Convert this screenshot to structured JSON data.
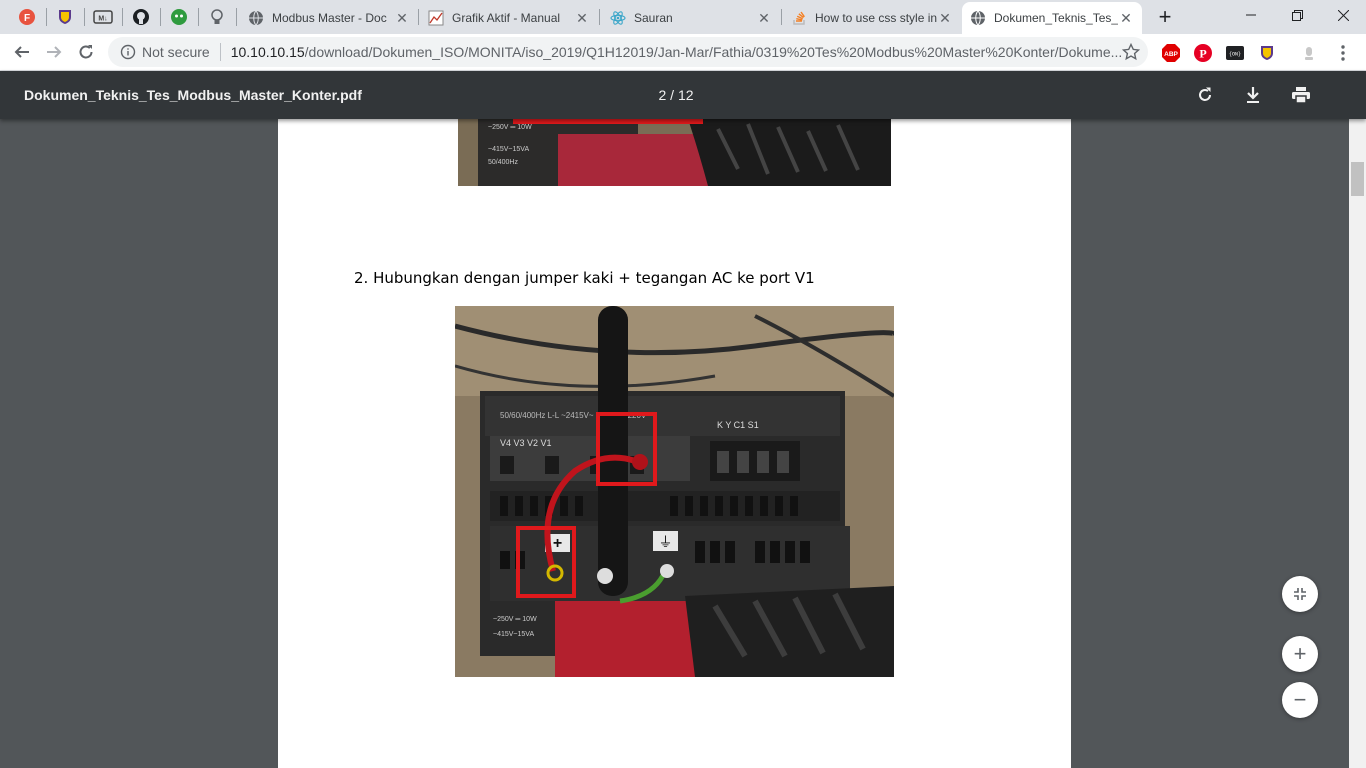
{
  "tabs": [
    {
      "label": "Modbus Master - Doc",
      "icon": "globe-icon"
    },
    {
      "label": "Grafik Aktif - Manual",
      "icon": "chart-icon"
    },
    {
      "label": "Sauran",
      "icon": "react-icon"
    },
    {
      "label": "How to use css style in",
      "icon": "stackoverflow-icon"
    },
    {
      "label": "Dokumen_Teknis_Tes_",
      "icon": "globe-icon",
      "active": true
    }
  ],
  "new_tab_label": "+",
  "address": {
    "security": "Not secure",
    "host": "10.10.10.15",
    "path": "/download/Dokumen_ISO/MONITA/iso_2019/Q1H12019/Jan-Mar/Fathia/0319%20Tes%20Modbus%20Master%20Konter/Dokume..."
  },
  "pdf": {
    "title": "Dokumen_Teknis_Tes_Modbus_Master_Konter.pdf",
    "page_indicator": "2 / 12"
  },
  "document": {
    "step_text": "2.  Hubungkan dengan jumper kaki + tegangan AC ke port V1",
    "photo_label_plus": "+",
    "photo_label_earth": "⏚"
  },
  "zoom": {
    "fit_label": "⤡",
    "in_label": "+",
    "out_label": "−"
  },
  "colors": {
    "accent_red": "#e0191c",
    "pdf_toolbar": "#323639",
    "viewer_bg": "#525659"
  }
}
